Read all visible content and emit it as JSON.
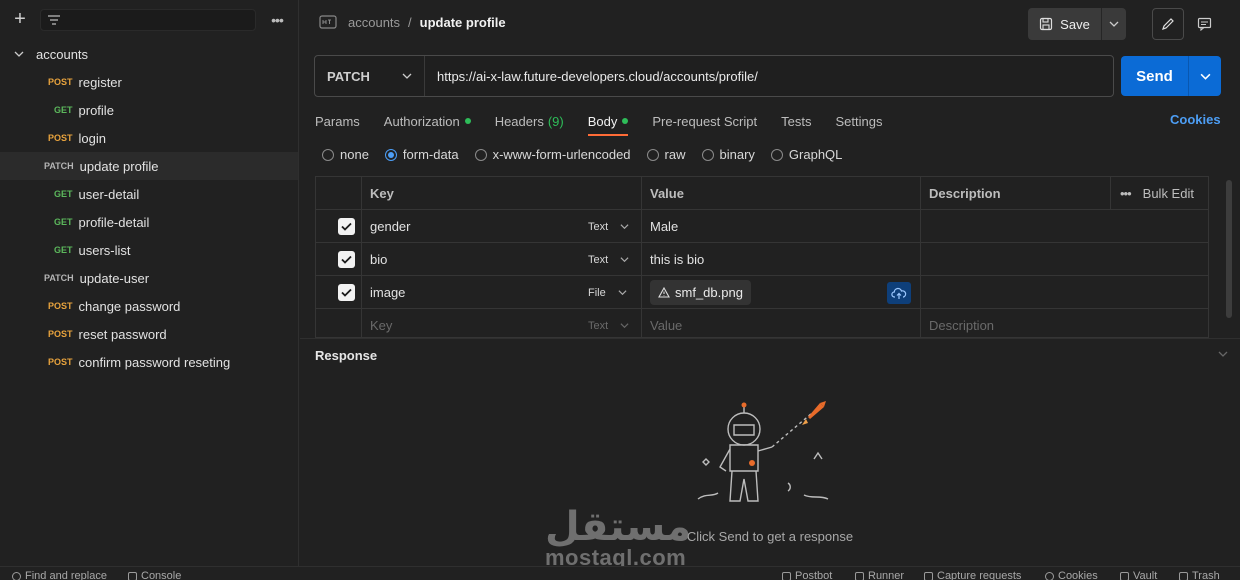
{
  "sidebar": {
    "collection": "accounts",
    "items": [
      {
        "method": "POST",
        "name": "register",
        "indent": 1
      },
      {
        "method": "GET",
        "name": "profile",
        "indent": 2
      },
      {
        "method": "POST",
        "name": "login",
        "indent": 1
      },
      {
        "method": "PATCH",
        "name": "update profile",
        "indent": 1,
        "selected": true
      },
      {
        "method": "GET",
        "name": "user-detail",
        "indent": 2
      },
      {
        "method": "GET",
        "name": "profile-detail",
        "indent": 2
      },
      {
        "method": "GET",
        "name": "users-list",
        "indent": 2
      },
      {
        "method": "PATCH",
        "name": "update-user",
        "indent": 1
      },
      {
        "method": "POST",
        "name": "change password",
        "indent": 1
      },
      {
        "method": "POST",
        "name": "reset password",
        "indent": 1
      },
      {
        "method": "POST",
        "name": "confirm password reseting",
        "indent": 1
      }
    ]
  },
  "header": {
    "breadcrumb_parent": "accounts",
    "breadcrumb_sep": "/",
    "breadcrumb_current": "update profile",
    "save_label": "Save"
  },
  "request": {
    "method": "PATCH",
    "url": "https://ai-x-law.future-developers.cloud/accounts/profile/",
    "send_label": "Send"
  },
  "tabs": [
    {
      "label": "Params"
    },
    {
      "label": "Authorization",
      "dot": true
    },
    {
      "label": "Headers",
      "count": "(9)"
    },
    {
      "label": "Body",
      "dot": true,
      "active": true
    },
    {
      "label": "Pre-request Script"
    },
    {
      "label": "Tests"
    },
    {
      "label": "Settings"
    }
  ],
  "cookies_label": "Cookies",
  "body_types": [
    {
      "label": "none"
    },
    {
      "label": "form-data",
      "selected": true
    },
    {
      "label": "x-www-form-urlencoded"
    },
    {
      "label": "raw"
    },
    {
      "label": "binary"
    },
    {
      "label": "GraphQL"
    }
  ],
  "table": {
    "headers": {
      "key": "Key",
      "value": "Value",
      "description": "Description",
      "bulk_edit": "Bulk Edit"
    },
    "rows": [
      {
        "checked": true,
        "key": "gender",
        "type": "Text",
        "value": "Male"
      },
      {
        "checked": true,
        "key": "bio",
        "type": "Text",
        "value": "this is bio"
      },
      {
        "checked": true,
        "key": "image",
        "type": "File",
        "value": "smf_db.png"
      }
    ],
    "placeholder": {
      "key": "Key",
      "type": "Text",
      "value": "Value",
      "description": "Description"
    }
  },
  "response": {
    "title": "Response",
    "empty_message": "Click Send to get a response"
  },
  "watermark": {
    "arabic": "مستقل",
    "latin": "mostaql.com"
  },
  "statusbar": {
    "find_replace": "Find and replace",
    "console": "Console",
    "postbot": "Postbot",
    "runner": "Runner",
    "capture": "Capture requests",
    "cookies": "Cookies",
    "vault": "Vault",
    "trash": "Trash"
  },
  "colors": {
    "accent_blue": "#0b6bd6",
    "post": "#e8a33d",
    "get": "#5cb85c",
    "active_tab": "#ff6c37",
    "status_green": "#2ebd59"
  }
}
